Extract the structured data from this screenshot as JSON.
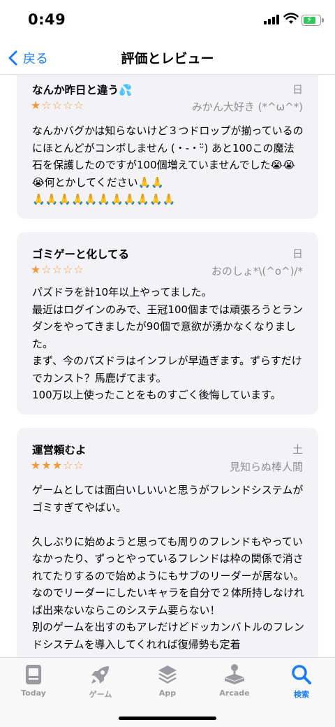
{
  "status_bar": {
    "time": "0:49"
  },
  "nav": {
    "back_label": "戻る",
    "title": "評価とレビュー"
  },
  "reviews": [
    {
      "title": "なんか昨日と違う💦",
      "date": "日",
      "author": "みかん大好き (*^ω^*)",
      "rating": 1,
      "body": "なんかバグかは知らないけど３つドロップが揃っているのにほとんどがコンボしません (・-・ᵕ̈) あと100この魔法石を保護したのですが100個増えていませんでした😭😭😭何とかしてください🙏🙏\n🙏🙏🙏🙏🙏🙏🙏🙏🙏🙏🙏"
    },
    {
      "title": "ゴミゲーと化してる",
      "date": "日",
      "author": "おのしょ*\\(^o^)/*",
      "rating": 1,
      "body": "パズドラを計10年以上やってました。\n最近はログインのみで、王冠100個までは頑張ろうとランダンをやってきましたが90個で意欲が湧かなくなりました。\nまず、今のパズドラはインフレが早過ぎます。ずらすだけでカンスト？馬鹿げてます。\n100万以上使ったことをものすごく後悔しています。"
    },
    {
      "title": "運営頼むよ",
      "date": "土",
      "author": "見知らぬ棒人間",
      "rating": 3,
      "body": "ゲームとしては面白いしいいと思うがフレンドシステムがゴミすぎてやばい。\n\n久しぶりに始めようと思っても周りのフレンドもやっていなかったり、ずっとやっているフレンドは枠の関係で消されてたりするので始めようにもサブのリーダーが居ない。\nなのでリーダーにしたいキャラを自分で２体所持しなければ出来ないならこのシステム要らない！\n別のゲームを出すのもアレだけどドッカンバトルのフレンドシステムを導入してくれれば復帰勢も定着"
    }
  ],
  "tabs": [
    {
      "label": "Today",
      "icon": "today-icon"
    },
    {
      "label": "ゲーム",
      "icon": "rocket-icon"
    },
    {
      "label": "App",
      "icon": "layers-icon"
    },
    {
      "label": "Arcade",
      "icon": "joystick-icon"
    },
    {
      "label": "検索",
      "icon": "search-icon",
      "active": true
    }
  ],
  "colors": {
    "accent": "#1a7cf5",
    "star": "#f09a37",
    "card": "#f2f2f7",
    "muted": "#8e8e93"
  }
}
